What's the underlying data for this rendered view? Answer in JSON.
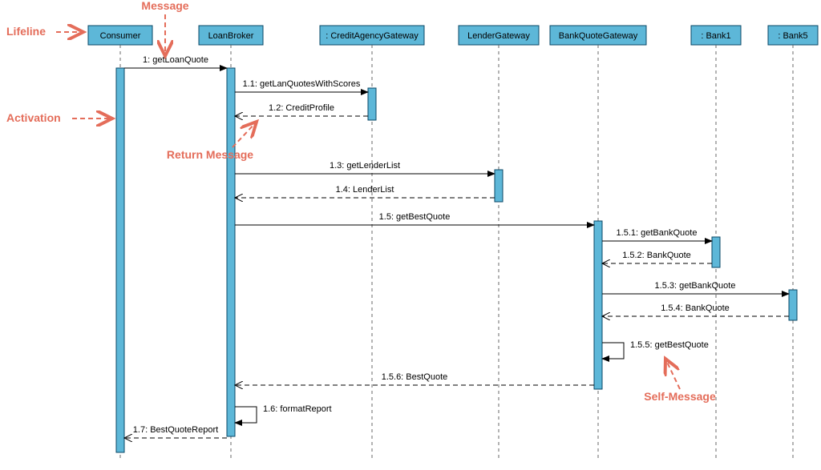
{
  "chart_data": {
    "type": "uml-sequence-diagram",
    "lifelines": [
      {
        "id": "consumer",
        "label": "Consumer"
      },
      {
        "id": "loanbroker",
        "label": "LoanBroker"
      },
      {
        "id": "creditagency",
        "label": ": CreditAgencyGateway"
      },
      {
        "id": "lendergw",
        "label": "LenderGateway"
      },
      {
        "id": "bankquotegw",
        "label": "BankQuoteGateway"
      },
      {
        "id": "bank1",
        "label": ": Bank1"
      },
      {
        "id": "bank5",
        "label": ": Bank5"
      }
    ],
    "messages": [
      {
        "seq": "1",
        "label": "1: getLoanQuote",
        "from": "consumer",
        "to": "loanbroker",
        "kind": "call"
      },
      {
        "seq": "1.1",
        "label": "1.1: getLanQuotesWithScores",
        "from": "loanbroker",
        "to": "creditagency",
        "kind": "call"
      },
      {
        "seq": "1.2",
        "label": "1.2: CreditProfile",
        "from": "creditagency",
        "to": "loanbroker",
        "kind": "return"
      },
      {
        "seq": "1.3",
        "label": "1.3: getLenderList",
        "from": "loanbroker",
        "to": "lendergw",
        "kind": "call"
      },
      {
        "seq": "1.4",
        "label": "1.4: LenderList",
        "from": "lendergw",
        "to": "loanbroker",
        "kind": "return"
      },
      {
        "seq": "1.5",
        "label": "1.5: getBestQuote",
        "from": "loanbroker",
        "to": "bankquotegw",
        "kind": "call"
      },
      {
        "seq": "1.5.1",
        "label": "1.5.1: getBankQuote",
        "from": "bankquotegw",
        "to": "bank1",
        "kind": "call"
      },
      {
        "seq": "1.5.2",
        "label": "1.5.2: BankQuote",
        "from": "bank1",
        "to": "bankquotegw",
        "kind": "return"
      },
      {
        "seq": "1.5.3",
        "label": "1.5.3: getBankQuote",
        "from": "bankquotegw",
        "to": "bank5",
        "kind": "call"
      },
      {
        "seq": "1.5.4",
        "label": "1.5.4: BankQuote",
        "from": "bank5",
        "to": "bankquotegw",
        "kind": "return"
      },
      {
        "seq": "1.5.5",
        "label": "1.5.5: getBestQuote",
        "from": "bankquotegw",
        "to": "bankquotegw",
        "kind": "self"
      },
      {
        "seq": "1.5.6",
        "label": "1.5.6: BestQuote",
        "from": "bankquotegw",
        "to": "loanbroker",
        "kind": "return"
      },
      {
        "seq": "1.6",
        "label": "1.6: formatReport",
        "from": "loanbroker",
        "to": "loanbroker",
        "kind": "self"
      },
      {
        "seq": "1.7",
        "label": "1.7: BestQuoteReport",
        "from": "loanbroker",
        "to": "consumer",
        "kind": "return"
      }
    ],
    "annotations": [
      {
        "id": "lifeline",
        "label": "Lifeline"
      },
      {
        "id": "message",
        "label": "Message"
      },
      {
        "id": "activation",
        "label": "Activation"
      },
      {
        "id": "returnmessage",
        "label": "Return Message"
      },
      {
        "id": "selfmessage",
        "label": "Self-Message"
      }
    ]
  }
}
